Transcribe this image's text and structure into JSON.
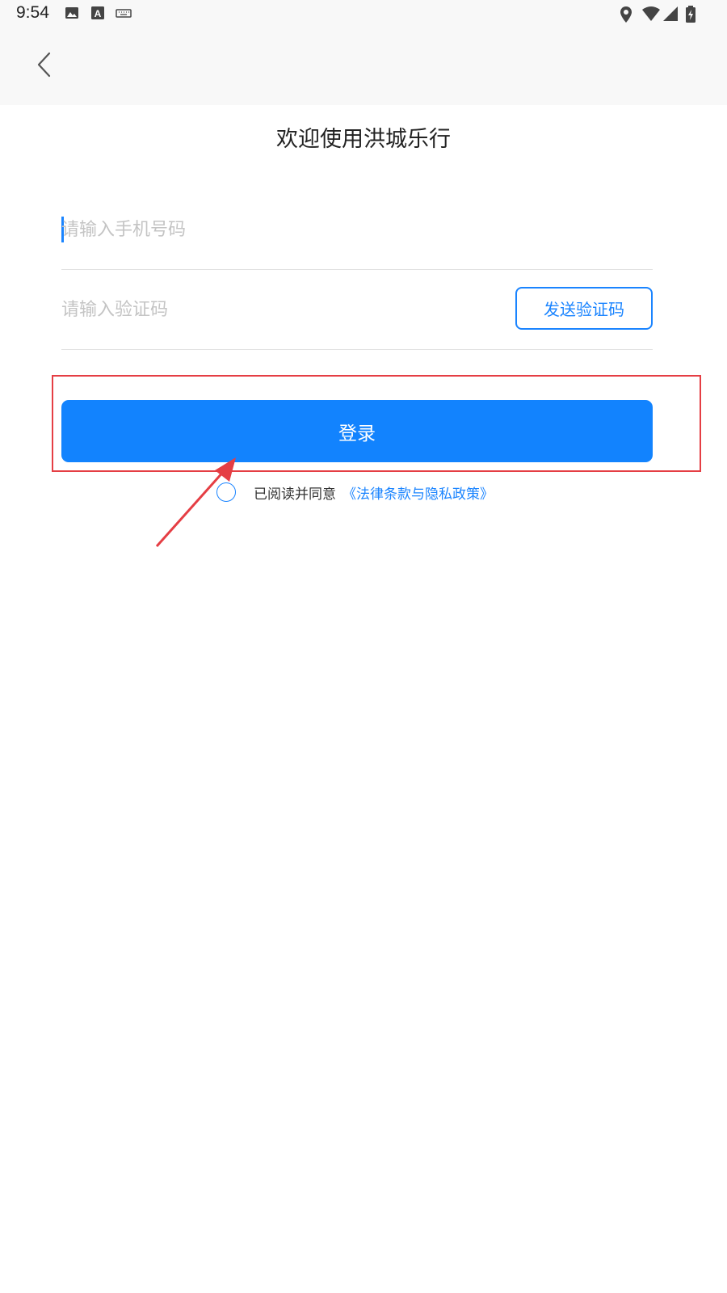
{
  "status_bar": {
    "time": "9:54",
    "left_icons": [
      "image-icon",
      "text-a-icon",
      "keyboard-icon"
    ],
    "right_icons": [
      "location-icon",
      "wifi-icon",
      "cellular-signal-icon",
      "battery-charging-icon"
    ]
  },
  "nav": {
    "back_icon": "chevron-left-icon"
  },
  "page": {
    "title": "欢迎使用洪城乐行"
  },
  "form": {
    "phone_placeholder": "请输入手机号码",
    "phone_value": "",
    "code_placeholder": "请输入验证码",
    "code_value": "",
    "send_code_label": "发送验证码",
    "login_label": "登录"
  },
  "agreement": {
    "checked": false,
    "prefix": "已阅读并同意",
    "link_text": "《法律条款与隐私政策》"
  },
  "colors": {
    "accent": "#1283fe",
    "annotation": "#e53e44"
  }
}
